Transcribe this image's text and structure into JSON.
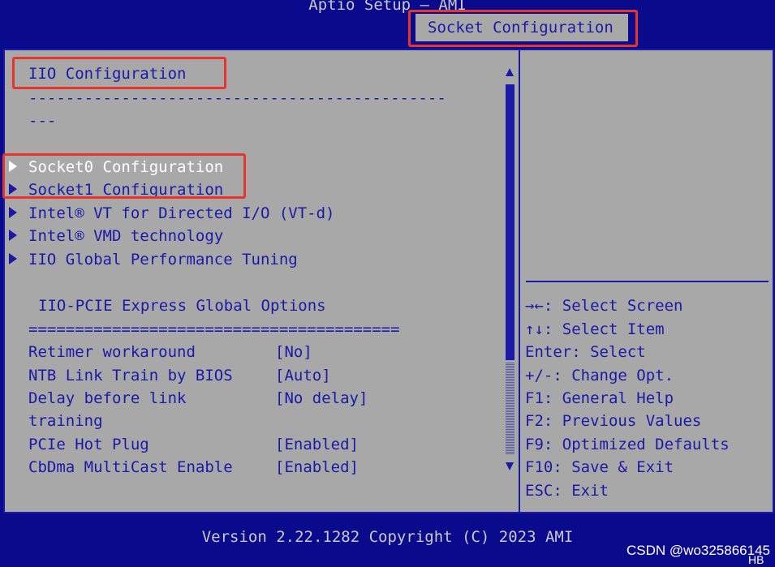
{
  "header": {
    "app_title": "Aptio Setup – AMI",
    "active_tab": "Socket Configuration"
  },
  "main": {
    "section_title": "IIO Configuration",
    "separator_line1": "---------------------------------------------",
    "separator_line2": "---",
    "submenus": [
      {
        "label": "Socket0 Configuration",
        "selected": true
      },
      {
        "label": "Socket1 Configuration",
        "selected": false
      },
      {
        "label": "Intel® VT for Directed I/O (VT-d)",
        "selected": false
      },
      {
        "label": "Intel® VMD technology",
        "selected": false
      },
      {
        "label": "IIO Global Performance Tuning",
        "selected": false
      }
    ],
    "pcie_group_title": "IIO-PCIE Express Global Options",
    "pcie_separator": "========================================",
    "options": [
      {
        "label": "Retimer workaround",
        "value": "[No]"
      },
      {
        "label": "NTB Link Train by BIOS",
        "value": "[Auto]"
      },
      {
        "label": "Delay before link",
        "label2": "training",
        "value": "[No delay]"
      },
      {
        "label": "PCIe Hot Plug",
        "value": "[Enabled]"
      },
      {
        "label": "CbDma MultiCast Enable",
        "value": "[Enabled]"
      }
    ]
  },
  "help": {
    "keys": [
      "→←: Select Screen",
      "↑↓: Select Item",
      "Enter: Select",
      "+/-: Change Opt.",
      "F1: General Help",
      "F2: Previous Values",
      "F9: Optimized Defaults",
      "F10: Save & Exit",
      "ESC: Exit"
    ]
  },
  "footer": {
    "version": "Version 2.22.1282 Copyright (C) 2023 AMI"
  },
  "watermark": {
    "text": "CSDN @wo325866145",
    "tag": "HB"
  },
  "colors": {
    "background": "#0a0a8c",
    "panel": "#a8a8a8",
    "text": "#1a1aa8",
    "selected_text": "#ffffff",
    "highlight": "#e8342a"
  }
}
